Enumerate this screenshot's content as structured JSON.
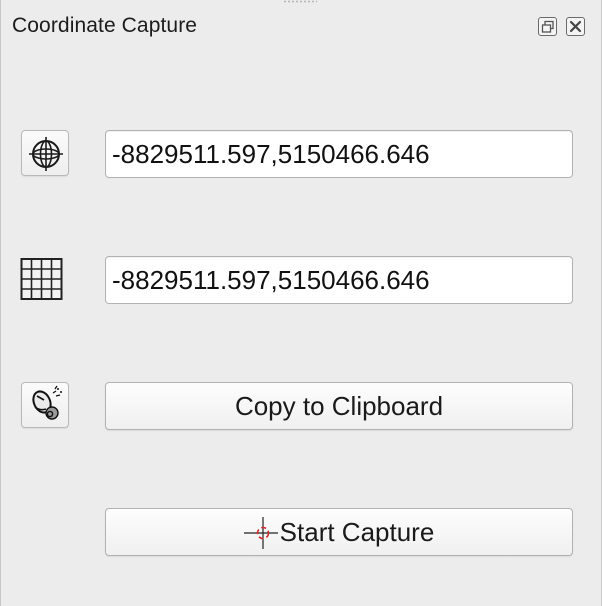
{
  "panel": {
    "title": "Coordinate Capture"
  },
  "title_buttons": {
    "float_icon": "float-window-icon",
    "close_icon": "close-icon"
  },
  "rows": {
    "map_crs": {
      "icon": "globe-crs-icon",
      "value": "-8829511.597,5150466.646"
    },
    "user_crs": {
      "icon": "grid-icon",
      "value": "-8829511.597,5150466.646"
    },
    "copy": {
      "icon": "mouse-copy-icon",
      "label": "Copy to Clipboard"
    },
    "capture": {
      "icon": "crosshair-icon",
      "label": "Start Capture"
    }
  },
  "colors": {
    "background": "#ececec",
    "crosshair": "#d0282c"
  }
}
